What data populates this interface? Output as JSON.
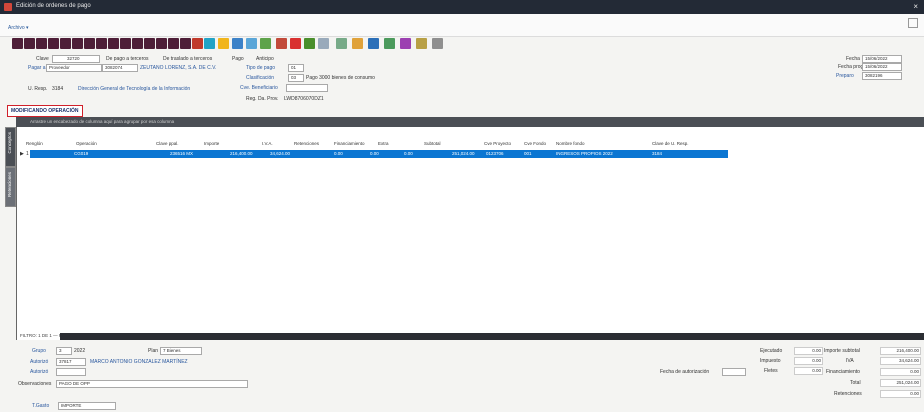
{
  "window": {
    "title": "Edición de ordenes de pago"
  },
  "menu": {
    "file_label": "Archivo ▾"
  },
  "header": {
    "clave_label": "Clave",
    "clave_value": "32720",
    "de_pago_label": "De pago a terceros",
    "de_pago_check": "De traslado a terceros",
    "pago_label": "Pago",
    "anticipo_label": "Anticipo",
    "pagar_a_label": "Pagar a",
    "pagar_a_type": "Proveedor",
    "pagar_a_code": "3082074",
    "pagar_a_name": "ZEUTANO LORENZ, S.A. DE C.V.",
    "tipo_pago_label": "Tipo de pago",
    "tipo_pago_value": "01",
    "clasificacion_label": "Clasificación",
    "clasificacion_value": "03",
    "clasificacion_desc": "Pago 3000 bienes de consumo",
    "cve_beneficiario_label": "Cve. Beneficiario",
    "u_resp_label": "U. Resp.",
    "u_resp_code": "3184",
    "u_resp_desc": "Dirección General de Tecnología de la Información",
    "reg_fed_label": "Reg. Da. Prov.",
    "reg_fed_value": "LWD8706070DZ1",
    "fecha_label": "Fecha",
    "fecha_value": "15/06/2022",
    "fecha_prog_label": "Fecha prog.",
    "fecha_prog_value": "15/06/2022",
    "elaboro_label": "Preparo",
    "elaboro_value": "3082196"
  },
  "status": {
    "operation": "MODIFICANDO OPERACIÓN"
  },
  "grid": {
    "group_hint": "Arrastre un encabezado de columna aquí para agrupar por esa columna",
    "side_tabs": [
      "Conceptos",
      "Retenciones"
    ],
    "columns": [
      "Renglón",
      "Operación",
      "Clave ppal.",
      "Importe",
      "I.V.A.",
      "Retenciones",
      "Financiamiento",
      "Extra",
      "Subtotal",
      "Cve Proyecto",
      "Cve Fondo",
      "Nombre fondo",
      "Clave de U. Resp."
    ],
    "rows": [
      {
        "renglon": "1",
        "operacion": "CG019",
        "clave": "236516 MX",
        "importe": "216,400.00",
        "iva": "34,624.00",
        "retenciones": "0.00",
        "financiamiento": "0.00",
        "extra": "0.00",
        "subtotal": "251,024.00",
        "proyecto": "0123706",
        "fondo": "001",
        "nombre_fondo": "INGRESOS PROPIOS 2022",
        "ures": "3184"
      }
    ],
    "footer_status": "FILTRO: 1 DE 1 — REGISTRO 1 DE 1"
  },
  "footer": {
    "grupo_label": "Grupo",
    "grupo_value": "3",
    "grupo_desc": "2022",
    "plan_label": "Plan",
    "plan_value": "7 Bienes",
    "autorizo_label": "Autorizó",
    "autorizo_code": "37817",
    "autorizo_name": "MARCO ANTONIO GONZALEZ MARTÍNEZ",
    "autorizo2_label": "Autorizó",
    "obs_label": "Observaciones",
    "obs_value": "PAGO DE OPP",
    "tiempo_label": "T.Gasto",
    "tiempo_value": "IMPORTE",
    "fecha_aut_label": "Fecha de autorización",
    "totals": [
      {
        "label": "Ejecutado",
        "value": "0.00"
      },
      {
        "label": "Impuesto",
        "value": "0.00"
      },
      {
        "label": "Fletes",
        "value": "0.00"
      }
    ],
    "totals_right": [
      {
        "label": "Importe subtotal",
        "value": "216,400.00"
      },
      {
        "label": "IVA",
        "value": "34,624.00"
      },
      {
        "label": "Financiamiento",
        "value": "0.00"
      },
      {
        "label": "Total",
        "value": "251,024.00"
      },
      {
        "label": "Retenciones",
        "value": "0.00"
      }
    ]
  }
}
